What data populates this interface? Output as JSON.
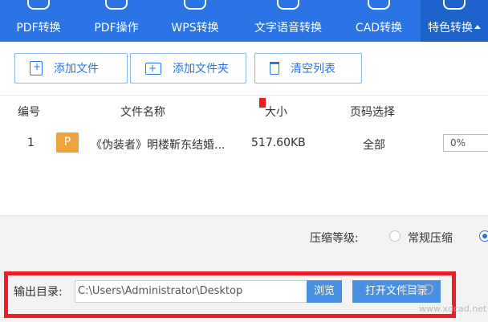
{
  "tabs": [
    {
      "label": "PDF转换",
      "active": false
    },
    {
      "label": "PDF操作",
      "active": false
    },
    {
      "label": "WPS转换",
      "active": false
    },
    {
      "label": "文字语音转换",
      "active": false
    },
    {
      "label": "CAD转换",
      "active": false
    },
    {
      "label": "特色转换",
      "active": true
    }
  ],
  "toolbar": {
    "add_file": "添加文件",
    "add_folder": "添加文件夹",
    "clear_list": "清空列表"
  },
  "table": {
    "headers": {
      "index": "编号",
      "name": "文件名称",
      "size": "大小",
      "page": "页码选择"
    },
    "rows": [
      {
        "index": "1",
        "type": "P",
        "name": "《伪装者》明楼靳东结婚...",
        "size": "517.60KB",
        "page": "全部",
        "progress": "0%"
      }
    ]
  },
  "compress": {
    "label": "压缩等级:",
    "option_normal": "常规压缩"
  },
  "output": {
    "label": "输出目录:",
    "path": "C:\\Users\\Administrator\\Desktop",
    "browse": "浏览",
    "open_dir": "打开文件目录"
  },
  "watermark": {
    "logo": "CAD",
    "url": "www.xdcad.net"
  },
  "colors": {
    "accent": "#2a74e6",
    "highlight": "#ee1c25",
    "file_badge": "#f0a23c"
  }
}
